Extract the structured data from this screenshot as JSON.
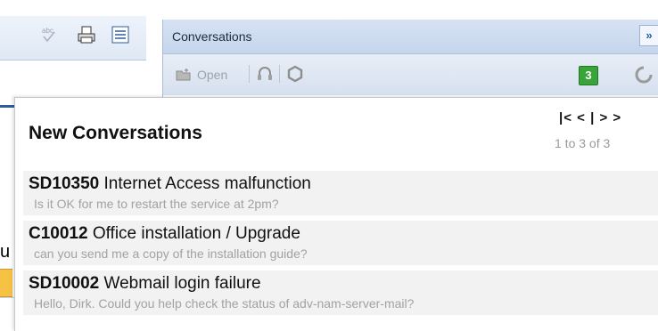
{
  "left_toolbar": {
    "icons": [
      "spellcheck-icon",
      "print-icon",
      "list-view-icon"
    ]
  },
  "left_fragment": {
    "letter": "u"
  },
  "panel": {
    "title": "Conversations",
    "expand_label": "»",
    "toolbar": {
      "open_label": "Open",
      "count": "3"
    }
  },
  "popup": {
    "title": "New Conversations",
    "pager": {
      "first": "|<",
      "prev": "<",
      "divider": "|",
      "next": ">",
      "last": ">",
      "info": "1 to 3 of 3"
    },
    "items": [
      {
        "id": "SD10350",
        "title": "Internet Access malfunction",
        "preview": "Is it OK for me to restart the service at 2pm?"
      },
      {
        "id": "C10012",
        "title": "Office installation / Upgrade",
        "preview": "can you send me a copy of the installation guide?"
      },
      {
        "id": "SD10002",
        "title": "Webmail login failure",
        "preview": "Hello, Dirk. Could you help check the status of adv-nam-server-mail?"
      }
    ]
  },
  "colors": {
    "accent": "#2b5aa8",
    "badge": "#3aa43a",
    "item_bg": "#f2f2f2",
    "muted_text": "#a2a2a2"
  }
}
